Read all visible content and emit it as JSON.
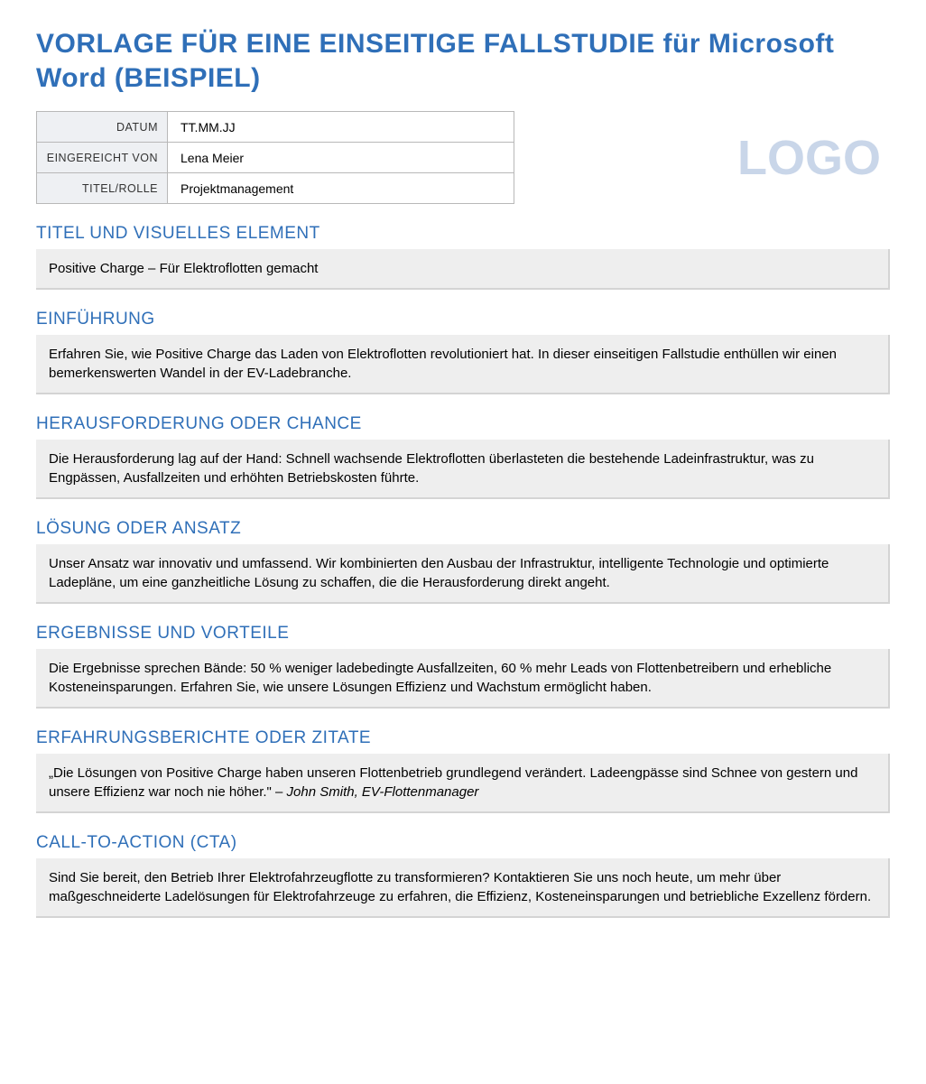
{
  "title": "VORLAGE FÜR EINE EINSEITIGE FALLSTUDIE für Microsoft Word (BEISPIEL)",
  "logo_text": "LOGO",
  "meta": {
    "rows": [
      {
        "label": "DATUM",
        "value": "TT.MM.JJ"
      },
      {
        "label": "EINGEREICHT VON",
        "value": "Lena Meier"
      },
      {
        "label": "TITEL/ROLLE",
        "value": "Projektmanagement"
      }
    ]
  },
  "sections": {
    "title_visual": {
      "heading": "TITEL UND VISUELLES ELEMENT",
      "body": "Positive Charge – Für Elektroflotten gemacht"
    },
    "intro": {
      "heading": "EINFÜHRUNG",
      "body": "Erfahren Sie, wie Positive Charge das Laden von Elektroflotten revolutioniert hat. In dieser einseitigen Fallstudie enthüllen wir einen bemerkenswerten Wandel in der EV-Ladebranche."
    },
    "challenge": {
      "heading": "HERAUSFORDERUNG ODER CHANCE",
      "body": "Die Herausforderung lag auf der Hand: Schnell wachsende Elektroflotten überlasteten die bestehende Ladeinfrastruktur, was zu Engpässen, Ausfallzeiten und erhöhten Betriebskosten führte."
    },
    "solution": {
      "heading": "LÖSUNG ODER ANSATZ",
      "body": "Unser Ansatz war innovativ und umfassend. Wir kombinierten den Ausbau der Infrastruktur, intelligente Technologie und optimierte Ladepläne, um eine ganzheitliche Lösung zu schaffen, die die Herausforderung direkt angeht."
    },
    "results": {
      "heading": "ERGEBNISSE UND VORTEILE",
      "body": "Die Ergebnisse sprechen Bände: 50 % weniger ladebedingte Ausfallzeiten, 60 % mehr Leads von Flottenbetreibern und erhebliche Kosteneinsparungen. Erfahren Sie, wie unsere Lösungen Effizienz und Wachstum ermöglicht haben."
    },
    "quotes": {
      "heading": "ERFAHRUNGSBERICHTE ODER ZITATE",
      "body": "„Die Lösungen von Positive Charge haben unseren Flottenbetrieb grundlegend verändert. Ladeengpässe sind Schnee von gestern und unsere Effizienz war noch nie höher.\" – ",
      "attribution": "John Smith, EV-Flottenmanager"
    },
    "cta": {
      "heading": "CALL-TO-ACTION (CTA)",
      "body": "Sind Sie bereit, den Betrieb Ihrer Elektrofahrzeugflotte zu transformieren? Kontaktieren Sie uns noch heute, um mehr über maßgeschneiderte Ladelösungen für Elektrofahrzeuge zu erfahren, die Effizienz, Kosteneinsparungen und betriebliche Exzellenz fördern."
    }
  }
}
